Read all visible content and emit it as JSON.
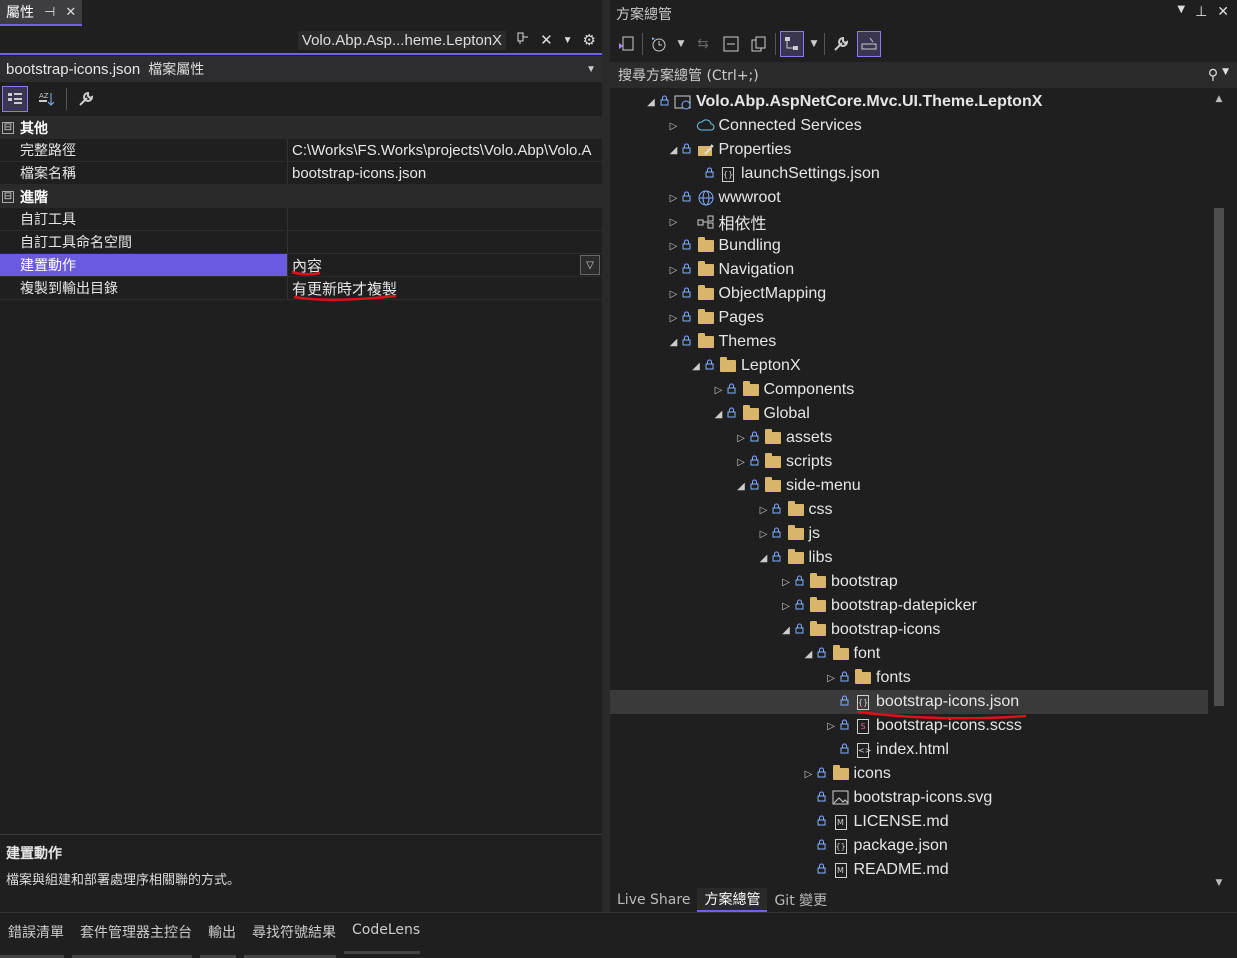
{
  "properties": {
    "tab_title": "屬性",
    "tab_pin": "⊣",
    "tab_close": "✕",
    "doc_context": "Volo.Abp.Asp...heme.LeptonX",
    "object_name": "bootstrap-icons.json",
    "object_type": "檔案屬性",
    "categories": [
      {
        "name": "其他",
        "toggle": "⊟",
        "rows": [
          {
            "key": "完整路徑",
            "value": "C:\\Works\\FS.Works\\projects\\Volo.Abp\\Volo.A"
          },
          {
            "key": "檔案名稱",
            "value": "bootstrap-icons.json"
          }
        ]
      },
      {
        "name": "進階",
        "toggle": "⊟",
        "rows": [
          {
            "key": "自訂工具",
            "value": ""
          },
          {
            "key": "自訂工具命名空間",
            "value": ""
          },
          {
            "key": "建置動作",
            "value": "內容"
          },
          {
            "key": "複製到輸出目錄",
            "value": "有更新時才複製"
          }
        ]
      }
    ],
    "description_title": "建置動作",
    "description_text": "檔案與組建和部署處理序相關聯的方式。"
  },
  "solution_explorer": {
    "title": "方案總管",
    "search_placeholder": "搜尋方案總管 (Ctrl+;)",
    "tree": [
      {
        "label": "Volo.Abp.AspNetCore.Mvc.UI.Theme.LeptonX",
        "depth": 0,
        "arrow": "◢",
        "lock": true,
        "icon": "project-icon",
        "bold": true
      },
      {
        "label": "Connected Services",
        "depth": 1,
        "arrow": "▷",
        "lock": false,
        "icon": "connected-services-icon"
      },
      {
        "label": "Properties",
        "depth": 1,
        "arrow": "◢",
        "lock": true,
        "icon": "properties-icon"
      },
      {
        "label": "launchSettings.json",
        "depth": 2,
        "arrow": "",
        "lock": true,
        "icon": "json-file-icon"
      },
      {
        "label": "wwwroot",
        "depth": 1,
        "arrow": "▷",
        "lock": true,
        "icon": "globe-icon"
      },
      {
        "label": "相依性",
        "depth": 1,
        "arrow": "▷",
        "lock": false,
        "icon": "dependencies-icon"
      },
      {
        "label": "Bundling",
        "depth": 1,
        "arrow": "▷",
        "lock": true,
        "icon": "folder-icon"
      },
      {
        "label": "Navigation",
        "depth": 1,
        "arrow": "▷",
        "lock": true,
        "icon": "folder-icon"
      },
      {
        "label": "ObjectMapping",
        "depth": 1,
        "arrow": "▷",
        "lock": true,
        "icon": "folder-icon"
      },
      {
        "label": "Pages",
        "depth": 1,
        "arrow": "▷",
        "lock": true,
        "icon": "folder-icon"
      },
      {
        "label": "Themes",
        "depth": 1,
        "arrow": "◢",
        "lock": true,
        "icon": "folder-icon"
      },
      {
        "label": "LeptonX",
        "depth": 2,
        "arrow": "◢",
        "lock": true,
        "icon": "folder-icon"
      },
      {
        "label": "Components",
        "depth": 3,
        "arrow": "▷",
        "lock": true,
        "icon": "folder-icon"
      },
      {
        "label": "Global",
        "depth": 3,
        "arrow": "◢",
        "lock": true,
        "icon": "folder-icon"
      },
      {
        "label": "assets",
        "depth": 4,
        "arrow": "▷",
        "lock": true,
        "icon": "folder-icon"
      },
      {
        "label": "scripts",
        "depth": 4,
        "arrow": "▷",
        "lock": true,
        "icon": "folder-icon"
      },
      {
        "label": "side-menu",
        "depth": 4,
        "arrow": "◢",
        "lock": true,
        "icon": "folder-icon"
      },
      {
        "label": "css",
        "depth": 5,
        "arrow": "▷",
        "lock": true,
        "icon": "folder-icon"
      },
      {
        "label": "js",
        "depth": 5,
        "arrow": "▷",
        "lock": true,
        "icon": "folder-icon"
      },
      {
        "label": "libs",
        "depth": 5,
        "arrow": "◢",
        "lock": true,
        "icon": "folder-icon"
      },
      {
        "label": "bootstrap",
        "depth": 6,
        "arrow": "▷",
        "lock": true,
        "icon": "folder-icon"
      },
      {
        "label": "bootstrap-datepicker",
        "depth": 6,
        "arrow": "▷",
        "lock": true,
        "icon": "folder-icon"
      },
      {
        "label": "bootstrap-icons",
        "depth": 6,
        "arrow": "◢",
        "lock": true,
        "icon": "folder-icon"
      },
      {
        "label": "font",
        "depth": 7,
        "arrow": "◢",
        "lock": true,
        "icon": "folder-icon"
      },
      {
        "label": "fonts",
        "depth": 8,
        "arrow": "▷",
        "lock": true,
        "icon": "folder-icon"
      },
      {
        "label": "bootstrap-icons.json",
        "depth": 8,
        "arrow": "",
        "lock": true,
        "icon": "json-file-icon",
        "selected": true
      },
      {
        "label": "bootstrap-icons.scss",
        "depth": 8,
        "arrow": "▷",
        "lock": true,
        "icon": "sass-file-icon"
      },
      {
        "label": "index.html",
        "depth": 8,
        "arrow": "",
        "lock": true,
        "icon": "html-file-icon"
      },
      {
        "label": "icons",
        "depth": 7,
        "arrow": "▷",
        "lock": true,
        "icon": "folder-icon"
      },
      {
        "label": "bootstrap-icons.svg",
        "depth": 7,
        "arrow": "",
        "lock": true,
        "icon": "image-file-icon"
      },
      {
        "label": "LICENSE.md",
        "depth": 7,
        "arrow": "",
        "lock": true,
        "icon": "markdown-file-icon"
      },
      {
        "label": "package.json",
        "depth": 7,
        "arrow": "",
        "lock": true,
        "icon": "json-file-icon"
      },
      {
        "label": "README.md",
        "depth": 7,
        "arrow": "",
        "lock": true,
        "icon": "markdown-file-icon"
      }
    ],
    "bottom_tabs": [
      "Live Share",
      "方案總管",
      "Git 變更"
    ],
    "active_tab": "方案總管"
  },
  "bottom_tool_tabs": [
    "錯誤清單",
    "套件管理器主控台",
    "輸出",
    "尋找符號結果",
    "CodeLens"
  ],
  "colors": {
    "accent": "#7160e8",
    "selected_row": "#6a5ae0",
    "annotation": "#e0101a",
    "folder": "#d8b56a"
  }
}
